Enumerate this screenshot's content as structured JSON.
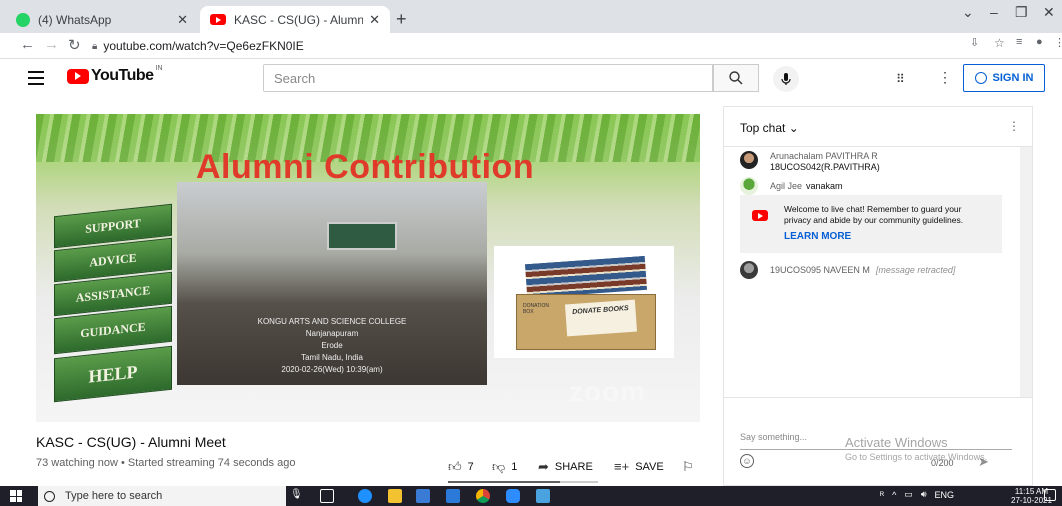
{
  "browser": {
    "tabs": [
      {
        "title": "(4) WhatsApp"
      },
      {
        "title": "KASC - CS(UG) - Alumni Meet - Y"
      }
    ],
    "url": "youtube.com/watch?v=Qe6ezFKN0IE"
  },
  "youtube": {
    "logo_text": "YouTube",
    "country_code": "IN",
    "search_placeholder": "Search",
    "sign_in_label": "SIGN IN"
  },
  "video": {
    "slide": {
      "title": "Alumni Contribution",
      "steps": [
        "HELP",
        "GUIDANCE",
        "ASSISTANCE",
        "ADVICE",
        "SUPPORT"
      ],
      "photo_caption": [
        "KONGU ARTS AND SCIENCE COLLEGE",
        "Nanjanapuram",
        "Erode",
        "Tamil Nadu, India",
        "2020-02-26(Wed)  10:39(am)"
      ],
      "donate_label": "DONATE BOOKS",
      "donation_box_label": "DONATION BOX",
      "watermark": "zoom"
    },
    "title": "KASC - CS(UG) - Alumni Meet",
    "meta": "73 watching now • Started streaming 74 seconds ago",
    "likes": "7",
    "dislikes": "1",
    "share_label": "SHARE",
    "save_label": "SAVE"
  },
  "chat": {
    "header": "Top chat",
    "messages": [
      {
        "author": "Arunachalam PAVITHRA R",
        "text": "18UCOS042(R.PAVITHRA)"
      },
      {
        "author": "Agil Jee",
        "text": "vanakam"
      },
      {
        "author": "19UCOS095 NAVEEN M",
        "text": "[message retracted]"
      }
    ],
    "welcome_text": "Welcome to live chat! Remember to guard your privacy and abide by our community guidelines.",
    "learn_more": "LEARN MORE",
    "input_placeholder": "Say something...",
    "char_count": "0/200"
  },
  "watermark": {
    "line1": "Activate Windows",
    "line2": "Go to Settings to activate Windows."
  },
  "taskbar": {
    "search_placeholder": "Type here to search",
    "lang": "ENG",
    "time": "11:15 AM",
    "date": "27-10-2021"
  }
}
